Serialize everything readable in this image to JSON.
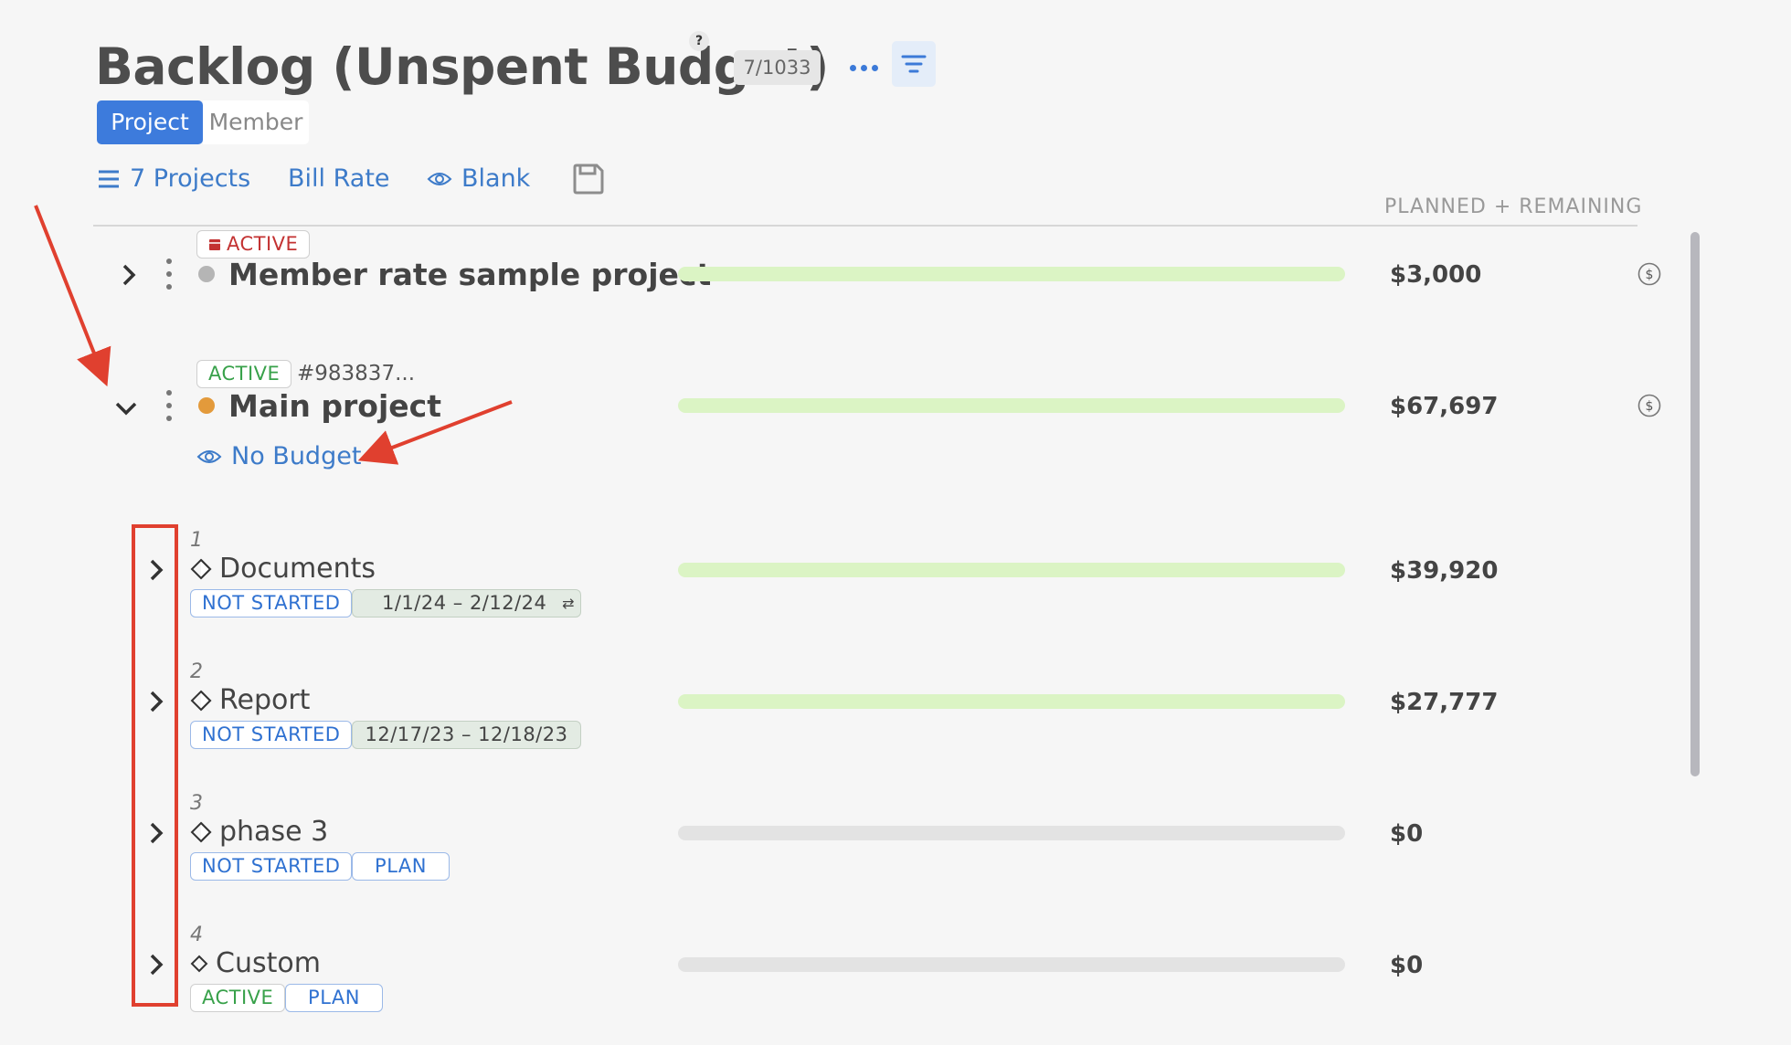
{
  "header": {
    "title": "Backlog (Unspent Budget)",
    "help": "?",
    "count": "7/1033"
  },
  "view_toggle": {
    "options": [
      "Project",
      "Member"
    ],
    "selected": "Project"
  },
  "toolbar": {
    "projects_label": "7 Projects",
    "bill_rate_label": "Bill Rate",
    "blank_label": "Blank"
  },
  "columns": {
    "value_header": "PLANNED + REMAINING"
  },
  "projects": [
    {
      "status": "ACTIVE",
      "name": "Member rate sample project",
      "amount": "$3,000",
      "dot_color": "#b5b5b5",
      "bar_fill": 1.0
    },
    {
      "status": "ACTIVE",
      "id": "#983837...",
      "name": "Main project",
      "amount": "$67,697",
      "dot_color": "#e39a3b",
      "budget_label": "No Budget",
      "bar_fill": 1.0
    }
  ],
  "phases": [
    {
      "number": "1",
      "name": "Documents",
      "status": "NOT STARTED",
      "dates": "1/1/24  –  2/12/24",
      "amount": "$39,920"
    },
    {
      "number": "2",
      "name": "Report",
      "status": "NOT STARTED",
      "dates": "12/17/23 – 12/18/23",
      "amount": "$27,777"
    },
    {
      "number": "3",
      "name": "phase 3",
      "status": "NOT STARTED",
      "plan": "PLAN",
      "amount": "$0"
    },
    {
      "number": "4",
      "name": "Custom",
      "status": "ACTIVE",
      "plan": "PLAN",
      "amount": "$0"
    }
  ],
  "colors": {
    "accent": "#3d7bdc",
    "bar_filled": "#dbf4c4",
    "bar_empty": "#e3e3e3",
    "annotation": "#e0402f"
  }
}
